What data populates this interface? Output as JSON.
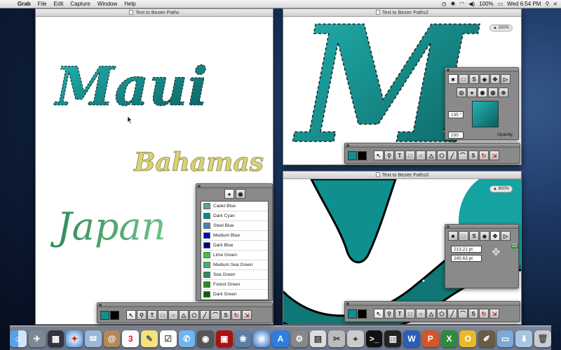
{
  "menubar": {
    "app_name": "Grab",
    "menus": [
      "File",
      "Edit",
      "Capture",
      "Window",
      "Help"
    ],
    "battery": "100%",
    "clock": "Wed 6:54 PM"
  },
  "window1": {
    "title": "Text to Bezier Paths",
    "words": [
      "Maui",
      "Bahamas",
      "Japan"
    ]
  },
  "window2": {
    "title": "Text to Bezier Paths2",
    "zoom": "▲ 200%",
    "letter": "M"
  },
  "window3": {
    "title": "Text to Bezier Paths3",
    "zoom": "▲ 800%"
  },
  "color_palette": {
    "colors": [
      {
        "name": "Cadet Blue",
        "hex": "#5f9ea0"
      },
      {
        "name": "Dark Cyan",
        "hex": "#008b8b"
      },
      {
        "name": "Steel Blue",
        "hex": "#4682b4"
      },
      {
        "name": "Medium Blue",
        "hex": "#0000cd"
      },
      {
        "name": "Dark Blue",
        "hex": "#00008b"
      },
      {
        "name": "Lime Green",
        "hex": "#32cd32"
      },
      {
        "name": "Medium Sea Green",
        "hex": "#3cb371"
      },
      {
        "name": "Sea Green",
        "hex": "#2e8b57"
      },
      {
        "name": "Forest Green",
        "hex": "#228b22"
      },
      {
        "name": "Dark Green",
        "hex": "#006400"
      }
    ]
  },
  "gradient_palette": {
    "angle": "135 °",
    "percent": "100 %",
    "opacity_label": "Opacity"
  },
  "transform_palette": {
    "x_value": "213.21 pt",
    "y_value": "245.63 pt",
    "badge": "2D"
  },
  "colors": {
    "teal": "#0f8f8d",
    "teal_dark": "#0a5f5e",
    "gold": "#d8d27a",
    "green": "#3f9b5e"
  }
}
